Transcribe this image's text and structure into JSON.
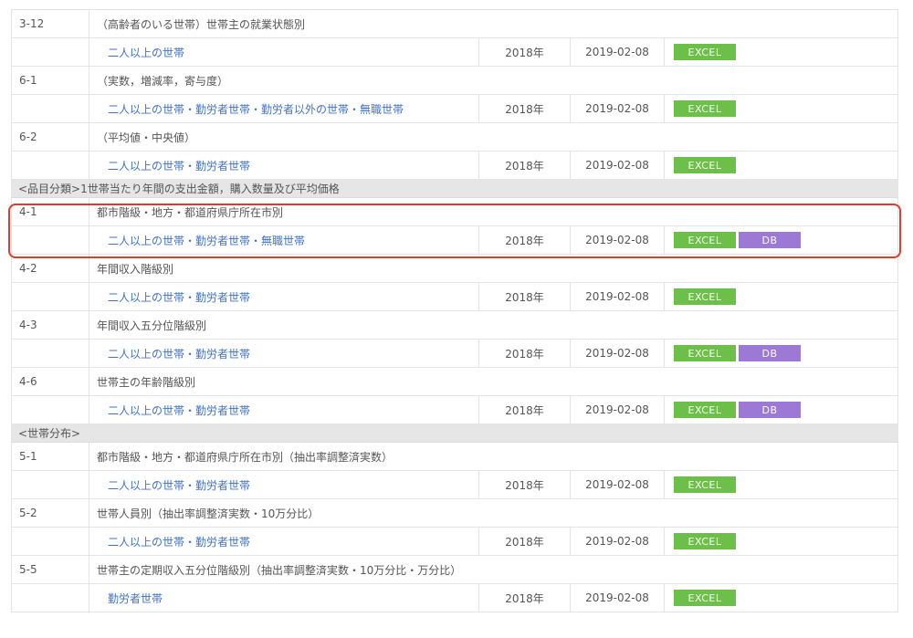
{
  "rows": [
    {
      "type": "entry",
      "num": "3-12",
      "title": "（高齢者のいる世帯）世帯主の就業状態別",
      "link": "二人以上の世帯",
      "year": "2018年",
      "date": "2019-02-08",
      "buttons": [
        "EXCEL"
      ]
    },
    {
      "type": "entry",
      "num": "6-1",
      "title": "（実数，増減率，寄与度）",
      "link": "二人以上の世帯・勤労者世帯・勤労者以外の世帯・無職世帯",
      "year": "2018年",
      "date": "2019-02-08",
      "buttons": [
        "EXCEL"
      ]
    },
    {
      "type": "entry",
      "num": "6-2",
      "title": "（平均値・中央値）",
      "link": "二人以上の世帯・勤労者世帯",
      "year": "2018年",
      "date": "2019-02-08",
      "buttons": [
        "EXCEL"
      ]
    },
    {
      "type": "category",
      "label": "<品目分類>1世帯当たり年間の支出金額，購入数量及び平均価格"
    },
    {
      "type": "entry",
      "num": "4-1",
      "title": "都市階級・地方・都道府県庁所在市別",
      "link": "二人以上の世帯・勤労者世帯・無職世帯",
      "year": "2018年",
      "date": "2019-02-08",
      "buttons": [
        "EXCEL",
        "DB"
      ],
      "highlighted": true
    },
    {
      "type": "entry",
      "num": "4-2",
      "title": "年間収入階級別",
      "link": "二人以上の世帯・勤労者世帯",
      "year": "2018年",
      "date": "2019-02-08",
      "buttons": [
        "EXCEL"
      ]
    },
    {
      "type": "entry",
      "num": "4-3",
      "title": "年間収入五分位階級別",
      "link": "二人以上の世帯・勤労者世帯",
      "year": "2018年",
      "date": "2019-02-08",
      "buttons": [
        "EXCEL",
        "DB"
      ]
    },
    {
      "type": "entry",
      "num": "4-6",
      "title": "世帯主の年齢階級別",
      "link": "二人以上の世帯・勤労者世帯",
      "year": "2018年",
      "date": "2019-02-08",
      "buttons": [
        "EXCEL",
        "DB"
      ]
    },
    {
      "type": "category",
      "label": "<世帯分布>"
    },
    {
      "type": "entry",
      "num": "5-1",
      "title": "都市階級・地方・都道府県庁所在市別（抽出率調整済実数）",
      "link": "二人以上の世帯・勤労者世帯",
      "year": "2018年",
      "date": "2019-02-08",
      "buttons": [
        "EXCEL"
      ]
    },
    {
      "type": "entry",
      "num": "5-2",
      "title": "世帯人員別（抽出率調整済実数・10万分比）",
      "link": "二人以上の世帯・勤労者世帯",
      "year": "2018年",
      "date": "2019-02-08",
      "buttons": [
        "EXCEL"
      ]
    },
    {
      "type": "entry",
      "num": "5-5",
      "title": "世帯主の定期収入五分位階級別（抽出率調整済実数・10万分比・万分比）",
      "link": "勤労者世帯",
      "year": "2018年",
      "date": "2019-02-08",
      "buttons": [
        "EXCEL"
      ]
    }
  ],
  "colors": {
    "excel": "#6cc04a",
    "db": "#9b79d4",
    "link": "#3f73c9",
    "highlight": "#e03a28",
    "category_bg": "#e6e6e6"
  }
}
